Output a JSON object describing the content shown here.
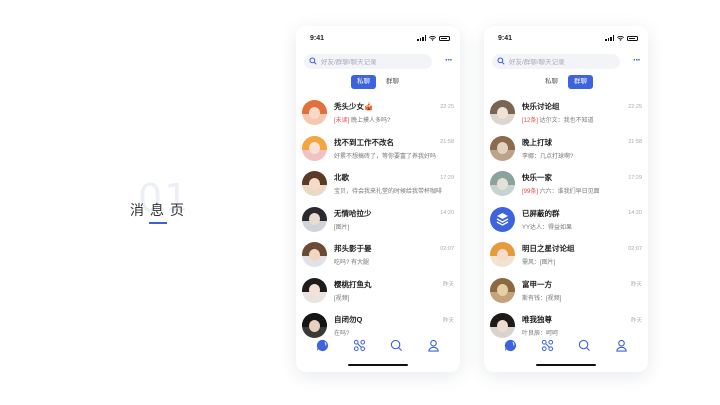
{
  "page_label": {
    "number": "01",
    "title": "消息页"
  },
  "colors": {
    "accent": "#3d63dd",
    "red_tag": "#e14b4b"
  },
  "phone1": {
    "time": "9:41",
    "search_placeholder": "好友/群聊/聊天记录",
    "tabs": [
      {
        "label": "私聊",
        "active": true
      },
      {
        "label": "群聊",
        "active": false
      }
    ],
    "items": [
      {
        "name": "秃头少女🎪",
        "tag": "[未读]",
        "message": " 晚上摸人多吗?",
        "time": "22:25"
      },
      {
        "name": "找不到工作不改名",
        "tag": "",
        "message": "好累不想搞砖了，等你要富了养我好吗",
        "time": "21:58"
      },
      {
        "name": "北歌",
        "tag": "",
        "message": "宝贝，待会我来扎堂的时候给我带杯咖啡",
        "time": "17:29"
      },
      {
        "name": "无情哈拉少",
        "tag": "",
        "message": "[图片]",
        "time": "14:20"
      },
      {
        "name": "邦头影于晏",
        "tag": "",
        "message": "吃吗? 有大腿",
        "time": "02:07"
      },
      {
        "name": "樱桃打鱼丸",
        "tag": "",
        "message": "[视频]",
        "time": "昨天"
      },
      {
        "name": "自闭勿Q",
        "tag": "",
        "message": "在吗?",
        "time": "昨天"
      }
    ],
    "nav": [
      "chat-icon",
      "share-icon",
      "search-icon",
      "profile-icon"
    ]
  },
  "phone2": {
    "time": "9:41",
    "search_placeholder": "好友/群聊/聊天记录",
    "tabs": [
      {
        "label": "私聊",
        "active": false
      },
      {
        "label": "群聊",
        "active": true
      }
    ],
    "items": [
      {
        "name": "快乐讨论组",
        "tag": "[12条]",
        "message": " 达尔文：我也不知道",
        "time": "22:25"
      },
      {
        "name": "晚上打球",
        "tag": "",
        "message": "李娜：几点打球啊?",
        "time": "21:58"
      },
      {
        "name": "快乐一家",
        "tag": "[99条]",
        "message": " 六六：谁我们早日见面",
        "time": "17:29"
      },
      {
        "name": "已屏蔽的群",
        "tag": "",
        "message": "YY达人：得益如果",
        "time": "14:20"
      },
      {
        "name": "明日之星讨论组",
        "tag": "",
        "message": "需风：[图片]",
        "time": "02:07"
      },
      {
        "name": "富甲一方",
        "tag": "",
        "message": "斯有钱：[视频]",
        "time": "昨天"
      },
      {
        "name": "唯我独尊",
        "tag": "",
        "message": "叶良辰：呵呵",
        "time": "昨天"
      }
    ],
    "nav": [
      "chat-icon",
      "share-icon",
      "search-icon",
      "profile-icon"
    ]
  }
}
